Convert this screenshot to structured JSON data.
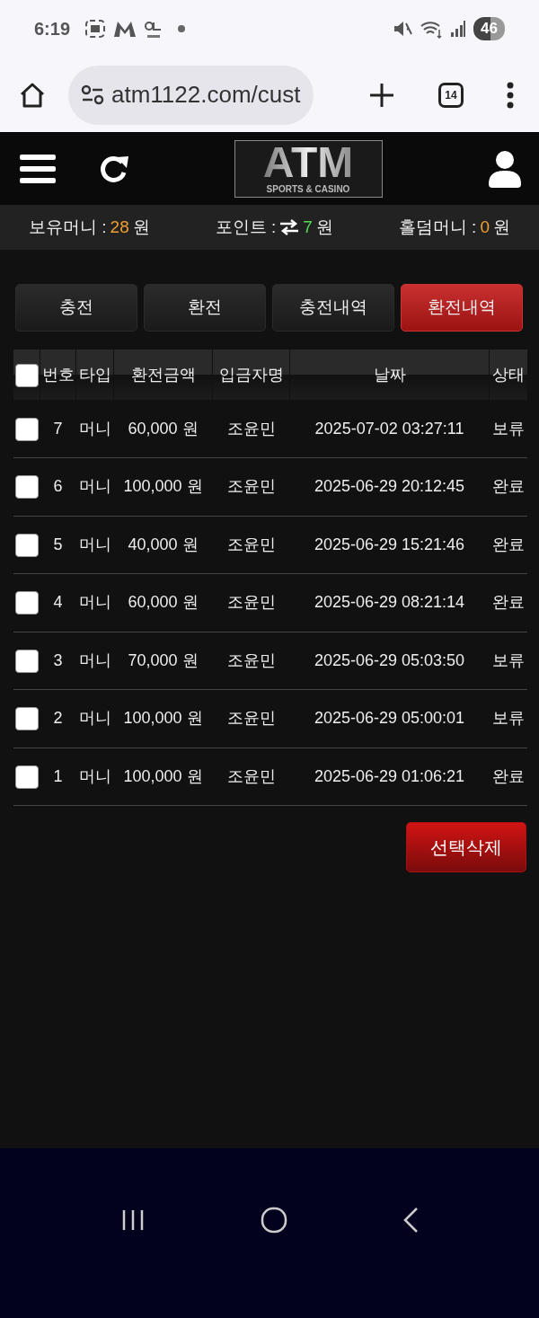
{
  "status_bar": {
    "time": "6:19",
    "battery": "46"
  },
  "browser": {
    "url": "atm1122.com/cust",
    "tab_count": "14"
  },
  "header": {
    "logo_title": "ATM",
    "logo_subtitle": "SPORTS & CASINO"
  },
  "balances": [
    {
      "label": "보유머니 :",
      "value": "28",
      "unit": "원",
      "color": "#f0a030",
      "kind": "plain"
    },
    {
      "label": "포인트 :",
      "value": "7",
      "unit": "원",
      "color": "#55dd55",
      "kind": "exchange"
    },
    {
      "label": "홀덤머니 :",
      "value": "0",
      "unit": "원",
      "color": "#f0a030",
      "kind": "plain"
    }
  ],
  "tabs": [
    {
      "label": "충전",
      "selected": false
    },
    {
      "label": "환전",
      "selected": false
    },
    {
      "label": "충전내역",
      "selected": false
    },
    {
      "label": "환전내역",
      "selected": true
    }
  ],
  "table": {
    "select_all_checked": false,
    "columns": [
      "번호",
      "타입",
      "환전금액",
      "입금자명",
      "날짜",
      "상태"
    ],
    "rows": [
      {
        "checked": false,
        "cells": [
          "7",
          "머니",
          "60,000 원",
          "조윤민",
          "2025-07-02 03:27:11",
          "보류"
        ]
      },
      {
        "checked": false,
        "cells": [
          "6",
          "머니",
          "100,000 원",
          "조윤민",
          "2025-06-29 20:12:45",
          "완료"
        ]
      },
      {
        "checked": false,
        "cells": [
          "5",
          "머니",
          "40,000 원",
          "조윤민",
          "2025-06-29 15:21:46",
          "완료"
        ]
      },
      {
        "checked": false,
        "cells": [
          "4",
          "머니",
          "60,000 원",
          "조윤민",
          "2025-06-29 08:21:14",
          "완료"
        ]
      },
      {
        "checked": false,
        "cells": [
          "3",
          "머니",
          "70,000 원",
          "조윤민",
          "2025-06-29 05:03:50",
          "보류"
        ]
      },
      {
        "checked": false,
        "cells": [
          "2",
          "머니",
          "100,000 원",
          "조윤민",
          "2025-06-29 05:00:01",
          "보류"
        ]
      },
      {
        "checked": false,
        "cells": [
          "1",
          "머니",
          "100,000 원",
          "조윤민",
          "2025-06-29 01:06:21",
          "완료"
        ]
      }
    ]
  },
  "delete_button": "선택삭제"
}
